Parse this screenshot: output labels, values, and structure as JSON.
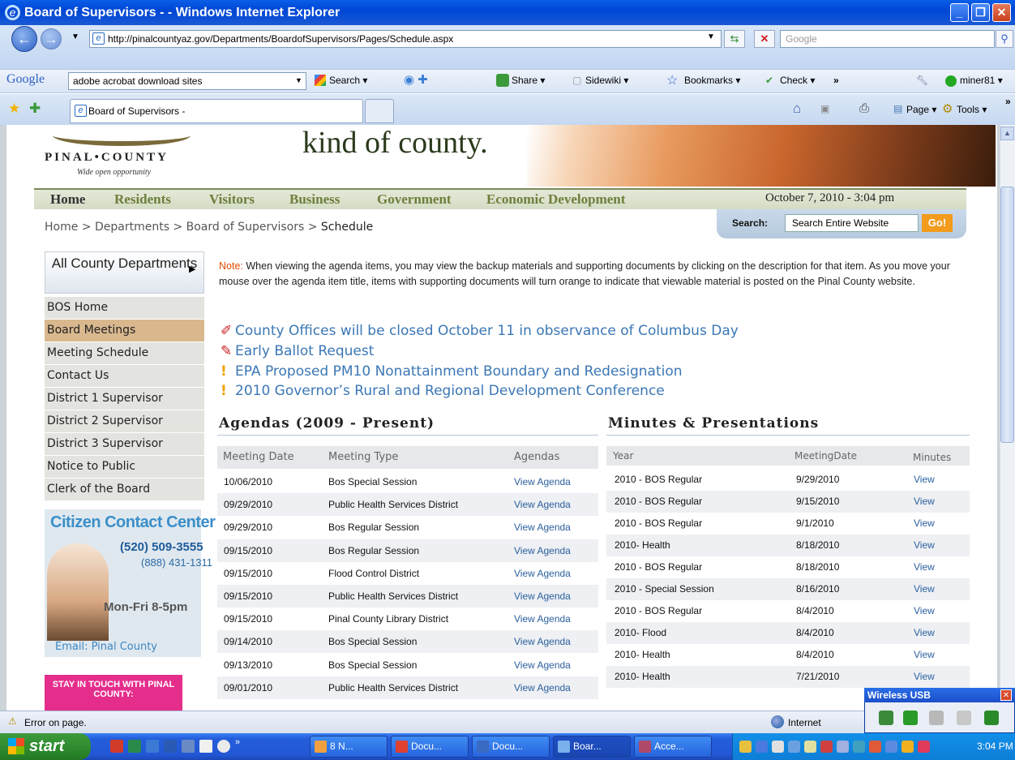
{
  "window": {
    "title": "Board of Supervisors - - Windows Internet Explorer"
  },
  "browser": {
    "address": "http://pinalcountyaz.gov/Departments/BoardofSupervisors/Pages/Schedule.aspx",
    "search_placeholder": "Google",
    "google_label": "Google",
    "google_query": "adobe acrobat download sites",
    "toolbar": {
      "search": "Search ▾",
      "share": "Share ▾",
      "sidewiki": "Sidewiki ▾",
      "bookmarks": "Bookmarks ▾",
      "check": "Check ▾",
      "more": "»",
      "user": "miner81 ▾"
    },
    "tab_title": "Board of Supervisors -",
    "page_menu": "Page ▾",
    "tools_menu": "Tools ▾"
  },
  "site": {
    "logo": "PINAL•COUNTY",
    "tagline": "Wide open opportunity",
    "banner": "kind of county.",
    "nav": [
      "Home",
      "Residents",
      "Visitors",
      "Business",
      "Government",
      "Economic Development"
    ],
    "date": "October 7, 2010 - 3:04 pm",
    "breadcrumb": {
      "home": "Home",
      "departments": "Departments",
      "bos": "Board of Supervisors",
      "sep": " > ",
      "current": "Schedule"
    },
    "search_label": "Search:",
    "search_value": "Search Entire Website",
    "go": "Go!"
  },
  "sidebar": {
    "all_county": "All County Departments",
    "items": [
      "BOS Home",
      "Board Meetings",
      "Meeting Schedule",
      "Contact Us",
      "District 1 Supervisor",
      "District 2 Supervisor",
      "District 3 Supervisor",
      "Notice to Public",
      "Clerk of the Board"
    ],
    "contact": {
      "title": "Citizen Contact Center",
      "phone1": "(520) 509-3555",
      "phone2": "(888) 431-1311",
      "hours": "Mon-Fri 8-5pm",
      "email": "Email: Pinal County"
    },
    "stay": "STAY IN TOUCH WITH PINAL COUNTY:"
  },
  "main": {
    "note_label": "Note:",
    "note_text": " When viewing the agenda items, you may view the backup materials and supporting documents by clicking on the description for that item. As you move your mouse over the agenda item title, items with supporting documents will turn orange to indicate that viewable material is posted on the Pinal County website.",
    "news": [
      "County Offices will be closed October 11 in observance of Columbus Day",
      "Early Ballot Request",
      "EPA Proposed PM10 Nonattainment Boundary and Redesignation",
      "2010 Governor’s Rural and Regional Development Conference"
    ],
    "agendas": {
      "heading": "Agendas (2009 - Present)",
      "columns": [
        "Meeting Date",
        "Meeting Type",
        "Agendas"
      ],
      "rows": [
        [
          "10/06/2010",
          "Bos Special Session",
          "View Agenda"
        ],
        [
          "09/29/2010",
          "Public Health Services District",
          "View Agenda"
        ],
        [
          "09/29/2010",
          "Bos Regular Session",
          "View Agenda"
        ],
        [
          "09/15/2010",
          "Bos Regular Session",
          "View Agenda"
        ],
        [
          "09/15/2010",
          "Flood Control District",
          "View Agenda"
        ],
        [
          "09/15/2010",
          "Public Health Services District",
          "View Agenda"
        ],
        [
          "09/15/2010",
          "Pinal County Library District",
          "View Agenda"
        ],
        [
          "09/14/2010",
          "Bos Special Session",
          "View Agenda"
        ],
        [
          "09/13/2010",
          "Bos Special Session",
          "View Agenda"
        ],
        [
          "09/01/2010",
          "Public Health Services District",
          "View Agenda"
        ]
      ]
    },
    "minutes": {
      "heading": "Minutes & Presentations",
      "columns": [
        "Year",
        "MeetingDate",
        "Minutes"
      ],
      "rows": [
        [
          "2010 - BOS Regular",
          "9/29/2010",
          "View"
        ],
        [
          "2010 - BOS Regular",
          "9/15/2010",
          "View"
        ],
        [
          "2010 - BOS Regular",
          "9/1/2010",
          "View"
        ],
        [
          "2010- Health",
          "8/18/2010",
          "View"
        ],
        [
          "2010 - BOS Regular",
          "8/18/2010",
          "View"
        ],
        [
          "2010 - Special Session",
          "8/16/2010",
          "View"
        ],
        [
          "2010 - BOS Regular",
          "8/4/2010",
          "View"
        ],
        [
          "2010- Flood",
          "8/4/2010",
          "View"
        ],
        [
          "2010- Health",
          "8/4/2010",
          "View"
        ],
        [
          "2010- Health",
          "7/21/2010",
          "View"
        ]
      ]
    }
  },
  "status": {
    "text": "Error on page.",
    "zone": "Internet"
  },
  "wireless": {
    "title": "Wireless USB"
  },
  "taskbar": {
    "start": "start",
    "tasks": [
      "8 N...",
      "Docu...",
      "Docu...",
      "Boar...",
      "Acce..."
    ],
    "clock": "3:04 PM"
  },
  "colors": {
    "link": "#2a5f9e",
    "nav_green": "#6c7f3c",
    "active_sidebar": "#d9b88e",
    "accent_orange": "#f29b1c"
  }
}
